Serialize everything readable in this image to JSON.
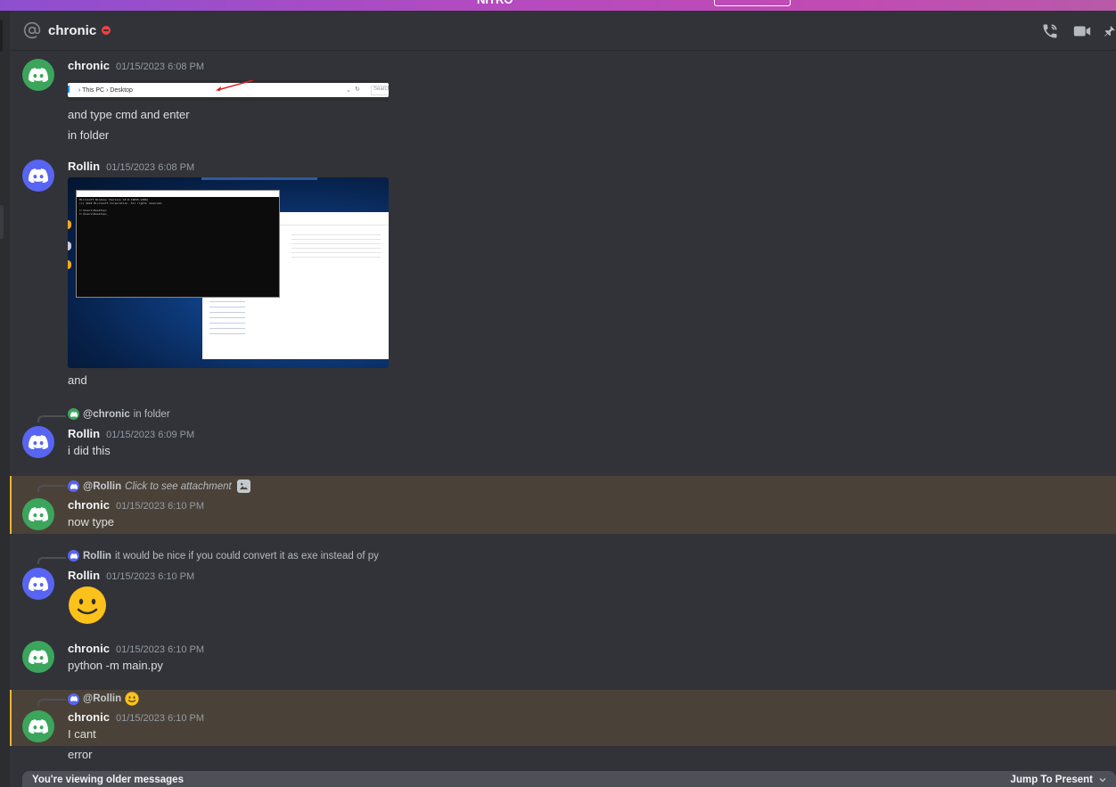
{
  "banner": {
    "text": "NITRO",
    "button_label": ""
  },
  "header": {
    "channel_prefix_icon": "at-icon",
    "title": "chronic",
    "status": "do-not-disturb",
    "status_color": "#f23f43",
    "icons": [
      "voice-call-icon",
      "video-call-icon",
      "pin-icon"
    ]
  },
  "colors": {
    "background": "#313338",
    "highlight": "#4a4238",
    "highlight_border": "#f0b232",
    "avatar_chronic": "#3ba55c",
    "avatar_rollin": "#5865f2"
  },
  "messages": [
    {
      "author": "chronic",
      "timestamp": "01/15/2023 6:08 PM",
      "attachment": {
        "type": "image",
        "description": "Explorer address bar screenshot",
        "breadcrumb": "› This PC › Desktop",
        "search_placeholder": "Search"
      },
      "lines": [
        "and type cmd and enter",
        "in folder"
      ]
    },
    {
      "author": "Rollin",
      "timestamp": "01/15/2023 6:08 PM",
      "attachment": {
        "type": "image",
        "description": "Windows desktop screenshot with command prompt",
        "cmd_lines": [
          "Microsoft Windows [Version 10.0.19045.2486]",
          "(c) 2022 Microsoft Corporation. All rights reserved.",
          "",
          "C:\\Users\\Desktop>",
          "C:\\Users\\Desktop>_"
        ]
      },
      "lines": [
        "and"
      ]
    },
    {
      "reply_to": {
        "name": "@chronic",
        "text": "in folder",
        "italic": false
      },
      "author": "Rollin",
      "timestamp": "01/15/2023 6:09 PM",
      "lines": [
        "i did this"
      ]
    },
    {
      "reply_to": {
        "name": "@Rollin",
        "text": "Click to see attachment",
        "italic": true,
        "icon": "image-icon"
      },
      "author": "chronic",
      "timestamp": "01/15/2023 6:10 PM",
      "highlighted": true,
      "lines": [
        "now type"
      ]
    },
    {
      "reply_to": {
        "name": "Rollin",
        "text": "it would be nice if you could convert it as exe instead of py",
        "italic": false
      },
      "author": "Rollin",
      "timestamp": "01/15/2023 6:10 PM",
      "emoji": "slightly-smiling-face",
      "lines": []
    },
    {
      "author": "chronic",
      "timestamp": "01/15/2023 6:10 PM",
      "lines": [
        "python -m main.py"
      ]
    },
    {
      "reply_to": {
        "name": "@Rollin",
        "text": "",
        "emoji": "slightly-smiling-face"
      },
      "author": "chronic",
      "timestamp": "01/15/2023 6:10 PM",
      "highlighted": true,
      "lines": [
        "I cant"
      ]
    },
    {
      "continuation": true,
      "lines": [
        "error"
      ]
    }
  ],
  "footer": {
    "older_notice": "You're viewing older messages",
    "jump_label": "Jump To Present",
    "jump_icon": "chevron-down-icon"
  }
}
